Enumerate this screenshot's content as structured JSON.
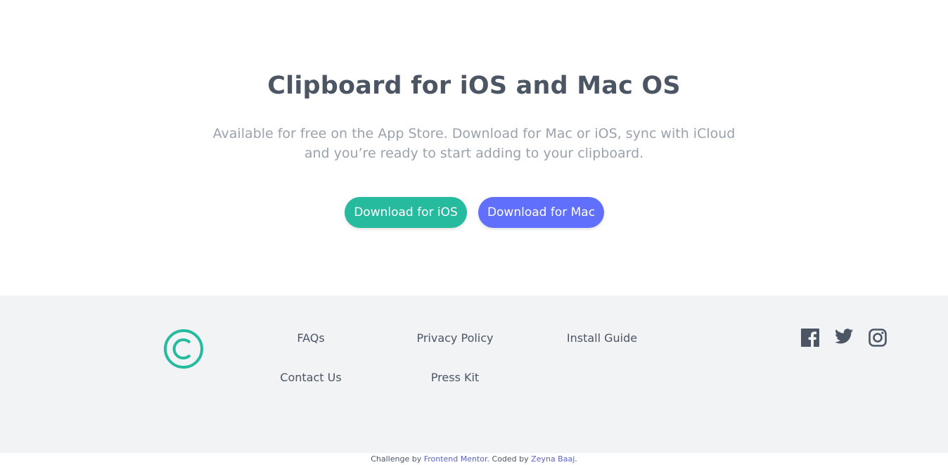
{
  "hero": {
    "title": "Clipboard for iOS and Mac OS",
    "description": "Available for free on the App Store. Download for Mac or iOS, sync with iCloud and you’re ready to start adding to your clipboard.",
    "buttons": {
      "ios_label": "Download for iOS",
      "mac_label": "Download for Mac"
    }
  },
  "colors": {
    "accent_green": "#26ba9f",
    "accent_blue": "#6070fd",
    "text_dark": "#4c5564",
    "text_light": "#9aa2ad",
    "footer_bg": "#f2f3f5"
  },
  "footer": {
    "logo_icon": "copyright-icon",
    "links": {
      "faqs": "FAQs",
      "privacy": "Privacy Policy",
      "install": "Install Guide",
      "contact": "Contact Us",
      "press": "Press Kit"
    },
    "social_icons": [
      "facebook-icon",
      "twitter-icon",
      "instagram-icon"
    ]
  },
  "attribution": {
    "prefix": "Challenge by ",
    "challenge_link": "Frontend Mentor",
    "middle": ". Coded by ",
    "author_link": "Zeyna Baaj",
    "suffix": "."
  }
}
